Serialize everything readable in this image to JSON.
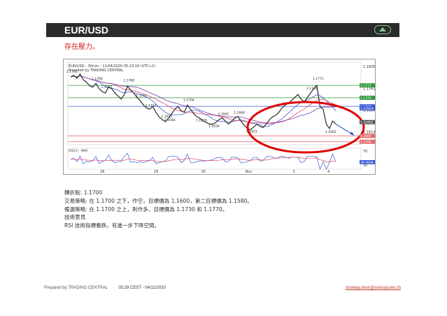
{
  "header": {
    "title": "EUR/USD"
  },
  "subtitle": "存在壓力。",
  "chart": {
    "header_line1": "EUR/USD - 30min - 11/04/2020 05:23:16 (UTC+2)",
    "header_line2": "Provided by TRADING CENTRAL",
    "rsi_label": "RSI14 - 9MA",
    "accent": "#d32020",
    "price_color": "#2b2b2b",
    "ma_colors": [
      "#3b5bd6",
      "#d8486a",
      "#7b3fb0"
    ],
    "level_colors": {
      "resistance": "#2e9a3a",
      "pivot": "#3b5bd6",
      "support": "#e36b6b",
      "annotation": "#e00000"
    }
  },
  "chart_data": {
    "type": "line",
    "title": "EUR/USD - 30min - 11/04/2020 05:23:16 (UTC+2)",
    "xlabel": "",
    "ylabel": "",
    "x_ticks": [
      "28",
      "29",
      "30",
      "Nov",
      "3",
      "4"
    ],
    "right_axis_ticks": [
      "1.1835",
      "1.1761",
      "1.1687",
      "1.1614",
      "70",
      "30"
    ],
    "price_tags": [
      {
        "value": "1.1771",
        "color": "#2e9a3a"
      },
      {
        "value": "1.1729",
        "color": "#2e9a3a"
      },
      {
        "value": "1.1700",
        "color": "#3b5bd6"
      },
      {
        "value": "1.16929",
        "color": "#3b5bd6"
      },
      {
        "value": "1.16465",
        "color": "#555555"
      },
      {
        "value": "1.1600",
        "color": "#e36b6b"
      },
      {
        "value": "1.1580",
        "color": "#e36b6b"
      },
      {
        "value": "39.3608",
        "color": "#3b5bd6"
      }
    ],
    "swing_labels": [
      "1.1795",
      "1.1766",
      "1.1765",
      "1.1768",
      "1.1741",
      "1.1718",
      "1.1695",
      "1.1704",
      "1.1648",
      "1.1659",
      "1.1639",
      "1.1661",
      "1.1666",
      "1.1621",
      "1.1740",
      "1.1771",
      "1.1602"
    ],
    "series": [
      {
        "values": [
          1.18,
          1.1805,
          1.1795,
          1.181,
          1.179,
          1.1782,
          1.177,
          1.1765,
          1.1778,
          1.176,
          1.175,
          1.1745,
          1.1765,
          1.176,
          1.1745,
          1.1735,
          1.1725,
          1.174,
          1.1768,
          1.1755,
          1.1745,
          1.173,
          1.172,
          1.1705,
          1.1695,
          1.169,
          1.17,
          1.168,
          1.1665,
          1.1655,
          1.1648,
          1.166,
          1.1675,
          1.169,
          1.17,
          1.1685,
          1.168,
          1.1704,
          1.169,
          1.1675,
          1.1665,
          1.1659,
          1.165,
          1.1645,
          1.164,
          1.1639,
          1.1645,
          1.1655,
          1.1661,
          1.165,
          1.164,
          1.165,
          1.166,
          1.1666,
          1.165,
          1.1635,
          1.1625,
          1.1621,
          1.163,
          1.164,
          1.1632,
          1.1628,
          1.164,
          1.1655,
          1.1665,
          1.167,
          1.168,
          1.1695,
          1.1705,
          1.171,
          1.172,
          1.173,
          1.174,
          1.1725,
          1.1715,
          1.173,
          1.1745,
          1.176,
          1.1771,
          1.17,
          1.169,
          1.164,
          1.1625,
          1.165,
          1.164
        ]
      }
    ],
    "arrow_target": 1.1602
  },
  "commentary": {
    "pivot": "轉折點: 1.1700",
    "strategy": "交易策略: 在 1.1700 之下，作空，目標價為 1.1600，第二目標價為 1.1580。",
    "alternative": "備選策略: 在 1.1700 之上，則作多，目標價為 1.1730 和 1.1770。",
    "technical_title": "技術意見",
    "technical_body": "RSI 技術指標看跌，有進一步下降空間。"
  },
  "footer": {
    "prepared": "Prepared by TRADING CENTRAL",
    "time": "05:29 CEST - 04/11/2020",
    "email": "strategy.desk@swissquote.ch"
  }
}
